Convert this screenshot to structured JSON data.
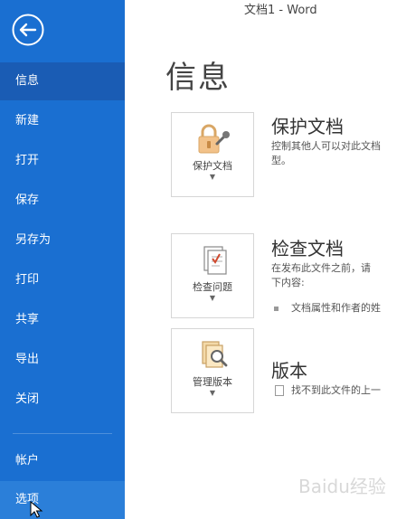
{
  "window": {
    "title": "文档1 - Word"
  },
  "sidebar": {
    "back_icon": "arrow-left-circle-icon",
    "items": [
      {
        "label": "信息",
        "state": "active"
      },
      {
        "label": "新建"
      },
      {
        "label": "打开"
      },
      {
        "label": "保存"
      },
      {
        "label": "另存为"
      },
      {
        "label": "打印"
      },
      {
        "label": "共享"
      },
      {
        "label": "导出"
      },
      {
        "label": "关闭"
      }
    ],
    "bottom_items": [
      {
        "label": "帐户"
      },
      {
        "label": "选项",
        "state": "hover"
      }
    ],
    "colors": {
      "background": "#1a6fd1",
      "active": "#1a5cb4",
      "hover": "#2b7fd9"
    }
  },
  "main": {
    "heading": "信息",
    "sections": [
      {
        "card_label": "保护文档",
        "card_icon": "lock-key-icon",
        "title": "保护文档",
        "lines": [
          "控制其他人可以对此文档",
          "型。"
        ]
      },
      {
        "card_label": "检查问题",
        "card_icon": "document-check-icon",
        "title": "检查文档",
        "lines": [
          "在发布此文件之前，请",
          "下内容:"
        ],
        "bullets": [
          "文档属性和作者的姓"
        ]
      },
      {
        "card_label": "管理版本",
        "card_icon": "document-search-icon",
        "title": "版本",
        "lines": [
          "找不到此文件的上一"
        ]
      }
    ]
  },
  "watermark": "Baidu经验"
}
